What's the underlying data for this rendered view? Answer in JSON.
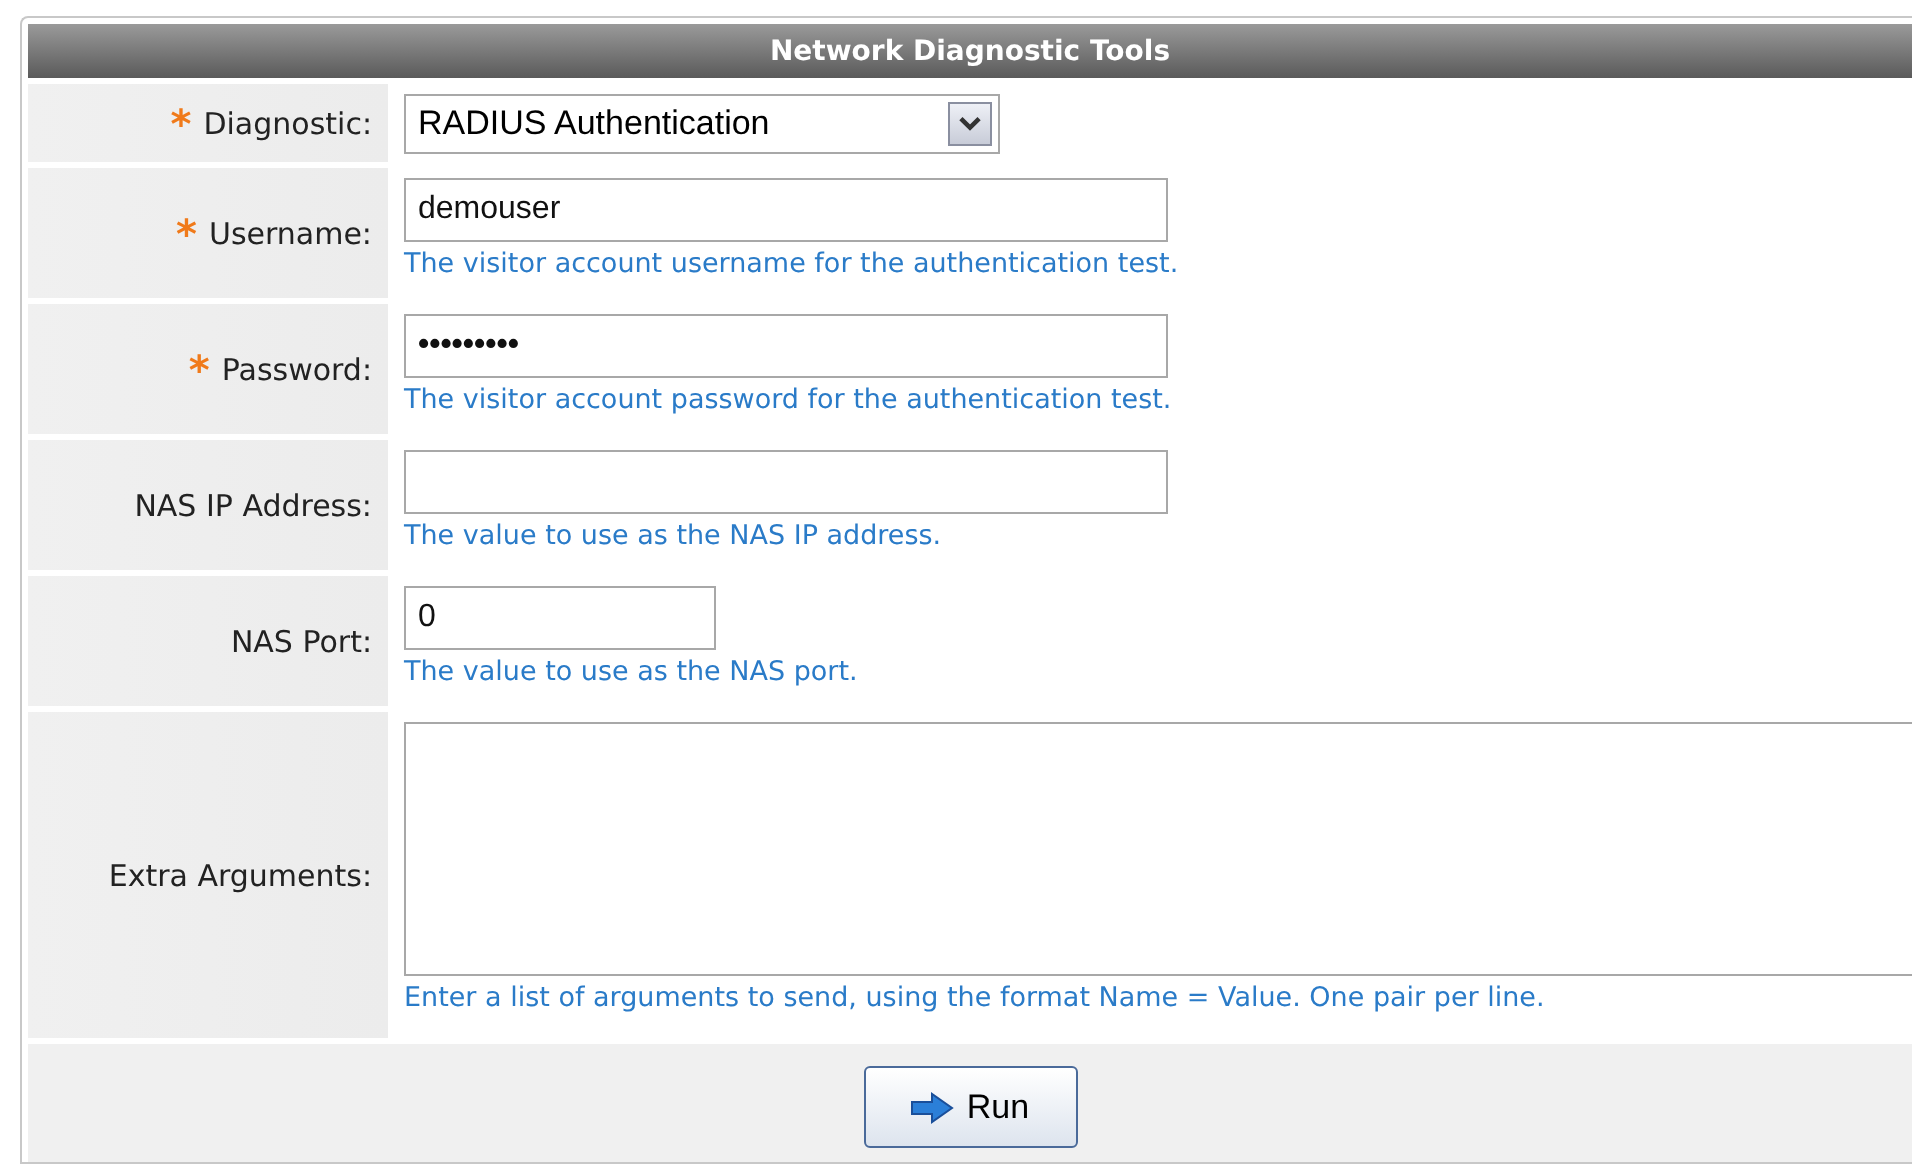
{
  "title": "Network Diagnostic Tools",
  "fields": [
    {
      "label": "Diagnostic:",
      "required_mark": "*",
      "kind": "select",
      "value": "RADIUS Authentication"
    },
    {
      "label": "Username:",
      "required_mark": "*",
      "kind": "text",
      "value": "demouser",
      "hint": "The visitor account username for the authentication test."
    },
    {
      "label": "Password:",
      "required_mark": "*",
      "kind": "password",
      "value": "•••••••••",
      "hint": "The visitor account password for the authentication test."
    },
    {
      "label": "NAS IP Address:",
      "kind": "text",
      "hint": "The value to use as the NAS IP address."
    },
    {
      "label": "NAS Port:",
      "kind": "short",
      "value": "0",
      "hint": "The value to use as the NAS port."
    },
    {
      "label": "Extra Arguments:",
      "kind": "textarea",
      "hint": "Enter a list of arguments to send, using the format Name = Value. One pair per line."
    }
  ],
  "button": "Run"
}
